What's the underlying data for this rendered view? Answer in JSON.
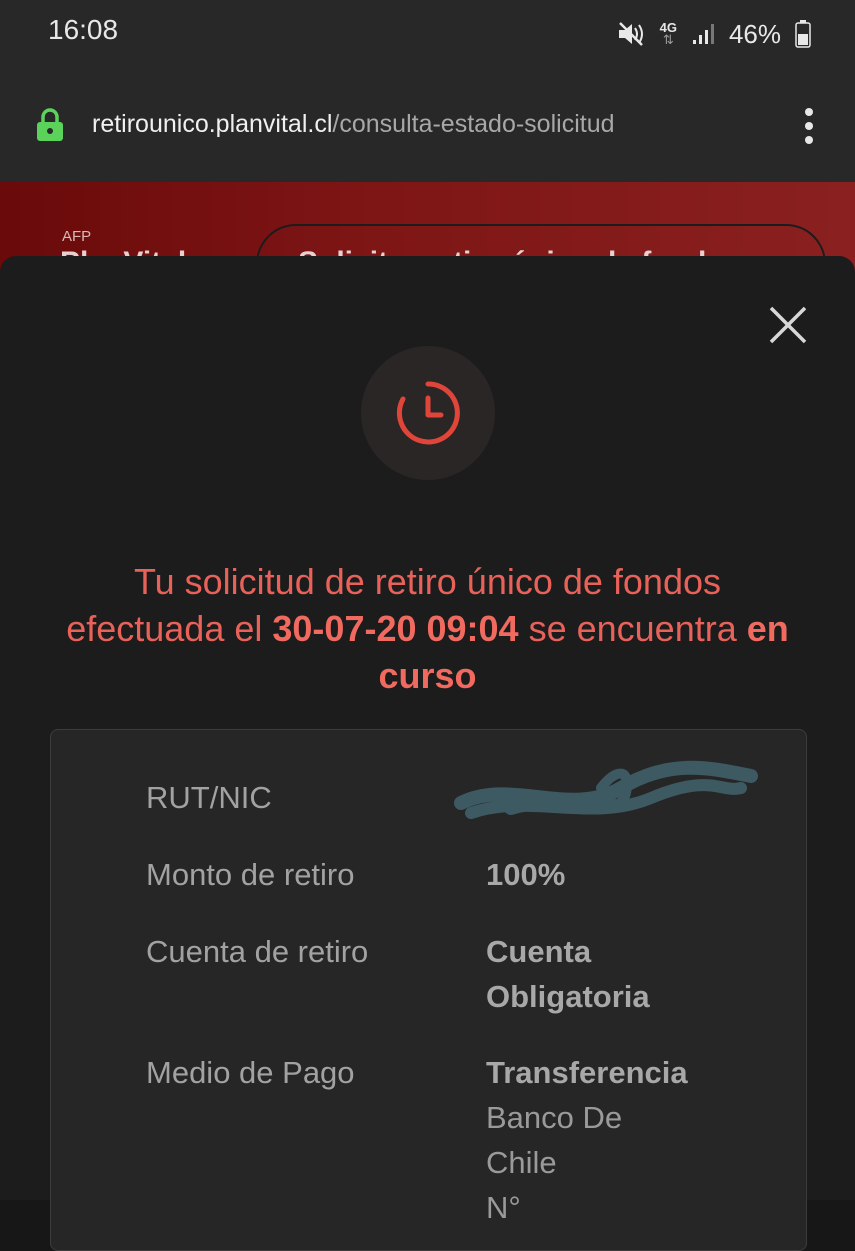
{
  "status_bar": {
    "time": "16:08",
    "battery_pct": "46%",
    "network": "4G",
    "icons": [
      "mute-icon",
      "network-4g-icon",
      "signal-icon",
      "battery-icon"
    ]
  },
  "browser": {
    "url_domain": "retirounico.planvital.cl",
    "url_path": "/consulta-estado-solicitud",
    "lock_color": "#5bd35b"
  },
  "page": {
    "afp_label": "AFP",
    "brand": "PlanVital",
    "header_button": "Solicitar retiro único de fondos"
  },
  "modal": {
    "message_prefix": "Tu solicitud de retiro único de fondos efectuada el",
    "message_datetime": "30-07-20 09:04",
    "message_middle": "se encuentra",
    "message_status": "en curso",
    "accent": "#e8625a",
    "details": {
      "rut_label": "RUT/NIC",
      "monto_label": "Monto de retiro",
      "monto_value": "100%",
      "cuenta_label": "Cuenta de retiro",
      "cuenta_value": "Cuenta Obligatoria",
      "pago_label": "Medio de Pago",
      "pago_value_strong": "Transferencia",
      "pago_value_bank": "Banco De Chile",
      "pago_value_more": "N°"
    }
  }
}
